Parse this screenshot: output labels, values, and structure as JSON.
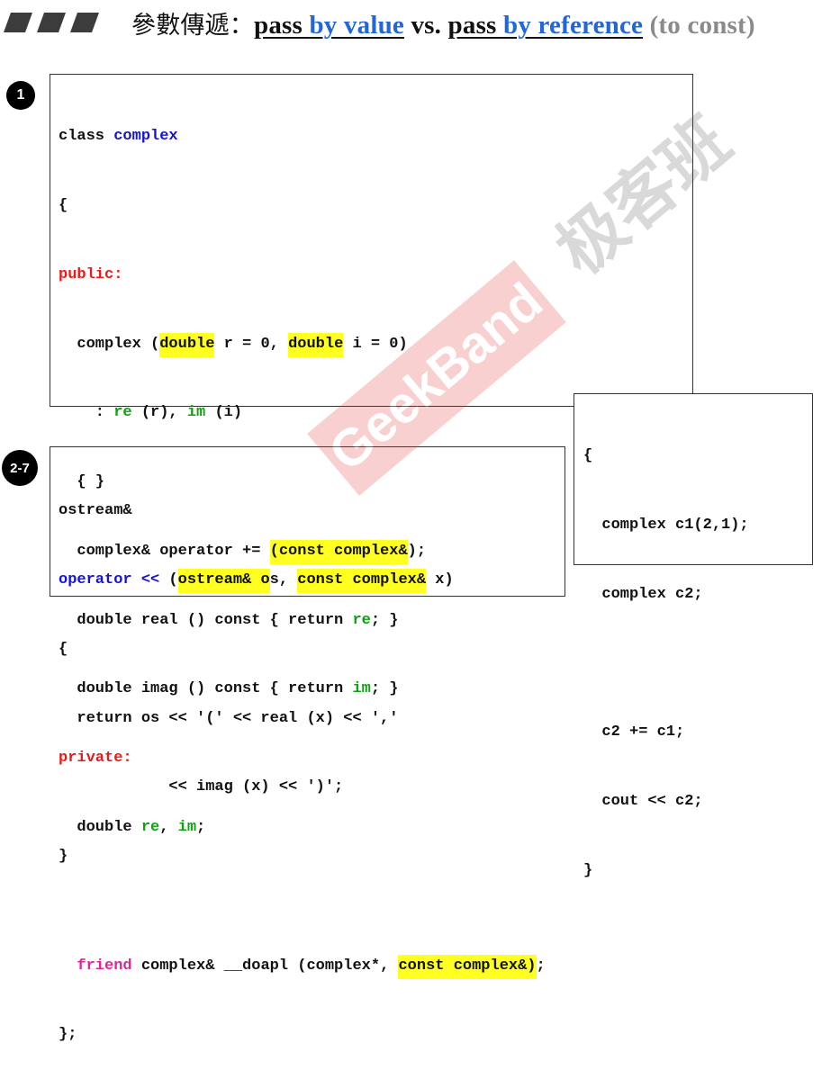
{
  "title": {
    "zh": "參數傳遞：",
    "p1": "pass ",
    "by_value": "by value",
    "vs": " vs. ",
    "p2": "pass ",
    "by_reference": "by reference",
    "suffix": " (to const)"
  },
  "badges": {
    "one": "1",
    "two": "2-7"
  },
  "code1": {
    "l1a": "class ",
    "l1b": "complex",
    "l2": "{",
    "l3": "public:",
    "l4a": "  complex (",
    "l4b": "double",
    "l4c": " r = 0, ",
    "l4d": "double",
    "l4e": " i = 0)",
    "l5a": "    : ",
    "l5b": "re",
    "l5c": " (r), ",
    "l5d": "im",
    "l5e": " (i)",
    "l6": "  { }",
    "l7a": "  complex& operator += ",
    "l7b": "(const complex&",
    "l7c": ");",
    "l8a": "  double real () const { return ",
    "l8b": "re",
    "l8c": "; }",
    "l9a": "  double imag () const { return ",
    "l9b": "im",
    "l9c": "; }",
    "l10": "private:",
    "l11a": "  double ",
    "l11b": "re",
    "l11c": ", ",
    "l11d": "im",
    "l11e": ";",
    "l12": "",
    "l13a": "  ",
    "l13b": "friend",
    "l13c": " complex& __doapl (complex*, ",
    "l13d": "const complex&)",
    "l13e": ";",
    "l14": "};"
  },
  "code2": {
    "l1": "ostream&",
    "l2a": "operator <<",
    "l2b": " (",
    "l2c": "ostream& o",
    "l2d": "s, ",
    "l2e": "const complex&",
    "l2f": " x)",
    "l3": "{",
    "l4": "  return os << '(' << real (x) << ','",
    "l5": "            << imag (x) << ')';",
    "l6": "}"
  },
  "code3": {
    "l1": "{",
    "l2": "  complex c1(2,1);",
    "l3": "  complex c2;",
    "l4": "",
    "l5": "  c2 += c1;",
    "l6": "  cout << c2;",
    "l7": "}"
  },
  "watermark": {
    "latin": "GeekBand",
    "zh": "极客班"
  },
  "colors": {
    "keyword_blue": "#1414d8",
    "keyword_red": "#ea1a1a",
    "member_green": "#11a011",
    "friend_pink": "#e0249a",
    "highlight": "#ffff20",
    "title_blue": "#2266dd"
  }
}
